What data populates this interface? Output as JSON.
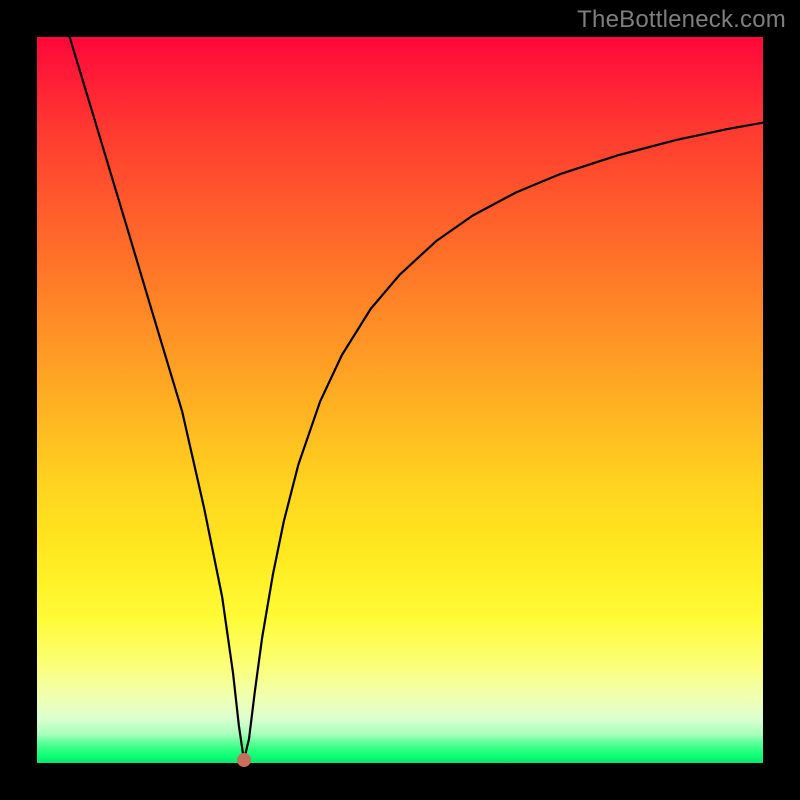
{
  "watermark": "TheBottleneck.com",
  "colors": {
    "frame": "#000000",
    "curve": "#000000",
    "marker": "#c86e5a",
    "watermark": "#7e7e7e"
  },
  "chart_data": {
    "type": "line",
    "title": "",
    "xlabel": "",
    "ylabel": "",
    "xlim": [
      0,
      100
    ],
    "ylim": [
      0,
      100
    ],
    "grid": false,
    "legend": false,
    "marker": {
      "x": 28.5,
      "y": 0.4
    },
    "series": [
      {
        "name": "bottleneck-curve",
        "x": [
          4.5,
          8,
          12,
          16,
          20,
          23,
          25.5,
          27,
          27.8,
          28.5,
          29.2,
          30,
          31,
          32.5,
          34,
          36,
          39,
          42,
          46,
          50,
          55,
          60,
          66,
          72,
          80,
          88,
          95,
          100
        ],
        "y": [
          100,
          88.4,
          75.1,
          61.7,
          48.4,
          35.2,
          22.9,
          12.4,
          5.2,
          0.4,
          3.3,
          9.8,
          17.2,
          26.0,
          33.3,
          41.1,
          49.8,
          56.2,
          62.6,
          67.3,
          71.9,
          75.4,
          78.6,
          81.1,
          83.7,
          85.8,
          87.3,
          88.2
        ]
      }
    ]
  }
}
